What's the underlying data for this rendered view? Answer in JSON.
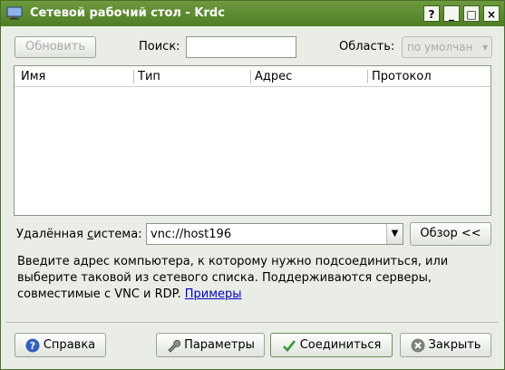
{
  "window": {
    "title": "Сетевой рабочий стол - Krdc",
    "help_glyph": "?",
    "minimize_glyph": "_",
    "maximize_glyph": "□",
    "close_glyph": "×"
  },
  "toolbar": {
    "refresh_label": "Обновить",
    "search_label": "Поиск:",
    "search_value": "",
    "scope_label": "Область:",
    "scope_value": "по умолчан"
  },
  "table": {
    "columns": [
      "Имя",
      "Тип",
      "Адрес",
      "Протокол"
    ],
    "rows": []
  },
  "remote": {
    "label": "Удалённая система:",
    "value": "vnc://host196",
    "browse_label": "Обзор <<"
  },
  "hint": {
    "text": "Введите адрес компьютера, к которому нужно подсоединиться, или выберите таковой из сетевого списка. Поддерживаются серверы, совместимые с VNC и RDP.",
    "link": "Примеры"
  },
  "buttons": {
    "help": "Справка",
    "settings": "Параметры",
    "connect": "Соединиться",
    "close": "Закрыть"
  },
  "icons": {
    "app": "monitor-icon",
    "help": "help-icon",
    "settings": "wrench-icon",
    "connect": "checkmark-icon",
    "close": "close-circle-icon"
  },
  "colors": {
    "titlebar": "#5a8a2f",
    "link": "#0000c8"
  }
}
